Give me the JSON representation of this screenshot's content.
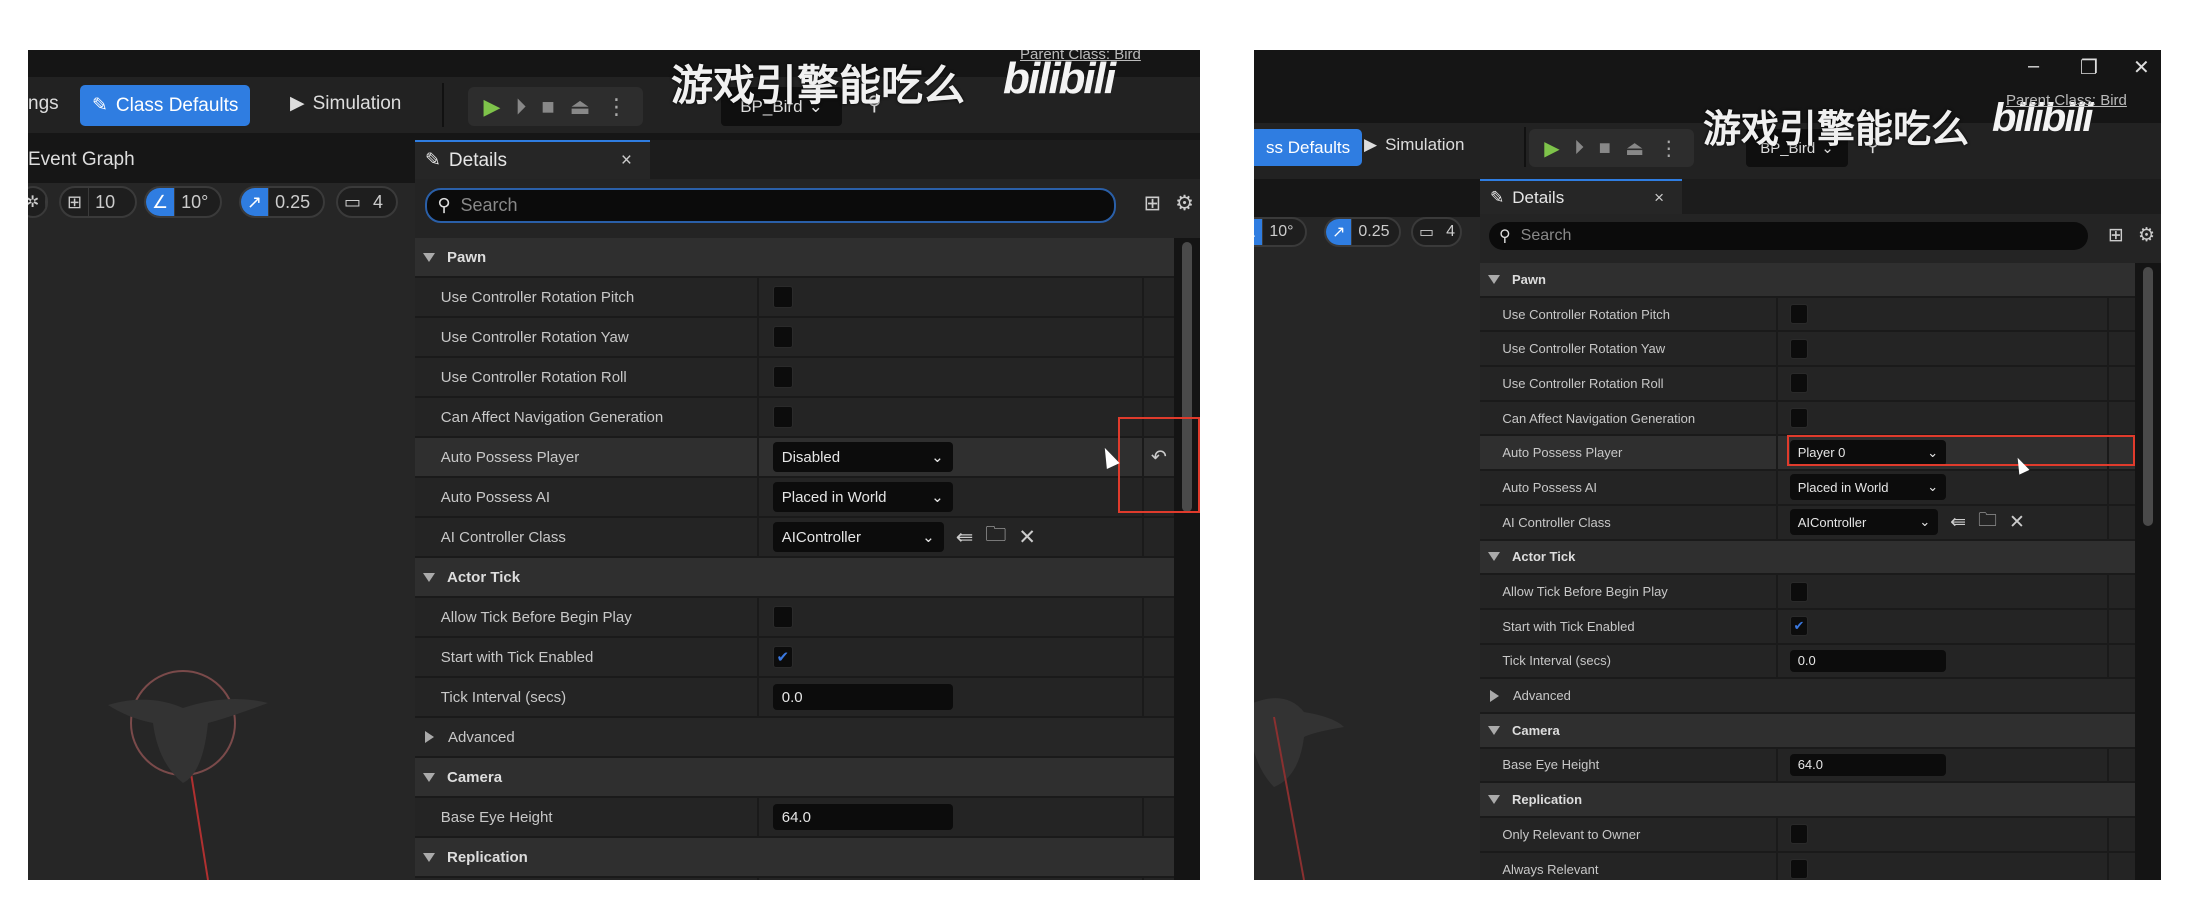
{
  "watermark": {
    "channel": "游戏引擎能吃么",
    "site": "bilibili",
    "parent_class": "Parent Class: Bird"
  },
  "toolbar": {
    "settings_partial": "ngs",
    "class_defaults": "Class Defaults",
    "class_defaults_partial": "ss Defaults",
    "simulation": "Simulation",
    "blueprint_selector": "BP_Bird"
  },
  "graph": {
    "tab_label": "Event Graph"
  },
  "viewport": {
    "grid_snap": "10",
    "rotation_snap": "10°",
    "scale_snap": "0.25",
    "camera_speed": "4"
  },
  "window_controls": {
    "minimize": "–",
    "restore": "❐",
    "close": "✕"
  },
  "details": {
    "title": "Details",
    "close": "×",
    "search_placeholder": "Search"
  },
  "left": {
    "rows": [
      {
        "type": "section",
        "label": "Pawn"
      },
      {
        "type": "checkbox",
        "label": "Use Controller Rotation Pitch",
        "checked": false
      },
      {
        "type": "checkbox",
        "label": "Use Controller Rotation Yaw",
        "checked": false
      },
      {
        "type": "checkbox",
        "label": "Use Controller Rotation Roll",
        "checked": false
      },
      {
        "type": "checkbox",
        "label": "Can Affect Navigation Generation",
        "checked": false
      },
      {
        "type": "dropdown",
        "label": "Auto Possess Player",
        "value": "Disabled",
        "highlight": true,
        "reset": true
      },
      {
        "type": "dropdown",
        "label": "Auto Possess AI",
        "value": "Placed in World"
      },
      {
        "type": "class",
        "label": "AI Controller Class",
        "value": "AIController"
      },
      {
        "type": "section",
        "label": "Actor Tick"
      },
      {
        "type": "checkbox",
        "label": "Allow Tick Before Begin Play",
        "checked": false
      },
      {
        "type": "checkbox",
        "label": "Start with Tick Enabled",
        "checked": true
      },
      {
        "type": "text",
        "label": "Tick Interval (secs)",
        "value": "0.0"
      },
      {
        "type": "advanced",
        "label": "Advanced"
      },
      {
        "type": "section",
        "label": "Camera"
      },
      {
        "type": "text",
        "label": "Base Eye Height",
        "value": "64.0"
      },
      {
        "type": "section",
        "label": "Replication"
      },
      {
        "type": "checkbox",
        "label": "",
        "checked": false
      }
    ]
  },
  "right": {
    "rows": [
      {
        "type": "section",
        "label": "Pawn"
      },
      {
        "type": "checkbox",
        "label": "Use Controller Rotation Pitch",
        "checked": false
      },
      {
        "type": "checkbox",
        "label": "Use Controller Rotation Yaw",
        "checked": false
      },
      {
        "type": "checkbox",
        "label": "Use Controller Rotation Roll",
        "checked": false
      },
      {
        "type": "checkbox",
        "label": "Can Affect Navigation Generation",
        "checked": false
      },
      {
        "type": "dropdown",
        "label": "Auto Possess Player",
        "value": "Player 0",
        "highlight": true
      },
      {
        "type": "dropdown",
        "label": "Auto Possess AI",
        "value": "Placed in World"
      },
      {
        "type": "class",
        "label": "AI Controller Class",
        "value": "AIController"
      },
      {
        "type": "section",
        "label": "Actor Tick"
      },
      {
        "type": "checkbox",
        "label": "Allow Tick Before Begin Play",
        "checked": false
      },
      {
        "type": "checkbox",
        "label": "Start with Tick Enabled",
        "checked": true
      },
      {
        "type": "text",
        "label": "Tick Interval (secs)",
        "value": "0.0"
      },
      {
        "type": "advanced",
        "label": "Advanced"
      },
      {
        "type": "section",
        "label": "Camera"
      },
      {
        "type": "text",
        "label": "Base Eye Height",
        "value": "64.0"
      },
      {
        "type": "section",
        "label": "Replication"
      },
      {
        "type": "checkbox",
        "label": "Only Relevant to Owner",
        "checked": false
      },
      {
        "type": "checkbox",
        "label": "Always Relevant",
        "checked": false
      }
    ]
  },
  "icons": {
    "reset": "reset-to-default-icon",
    "use_selected": "use-selected-icon",
    "browse": "browse-icon",
    "clear": "clear-icon"
  }
}
